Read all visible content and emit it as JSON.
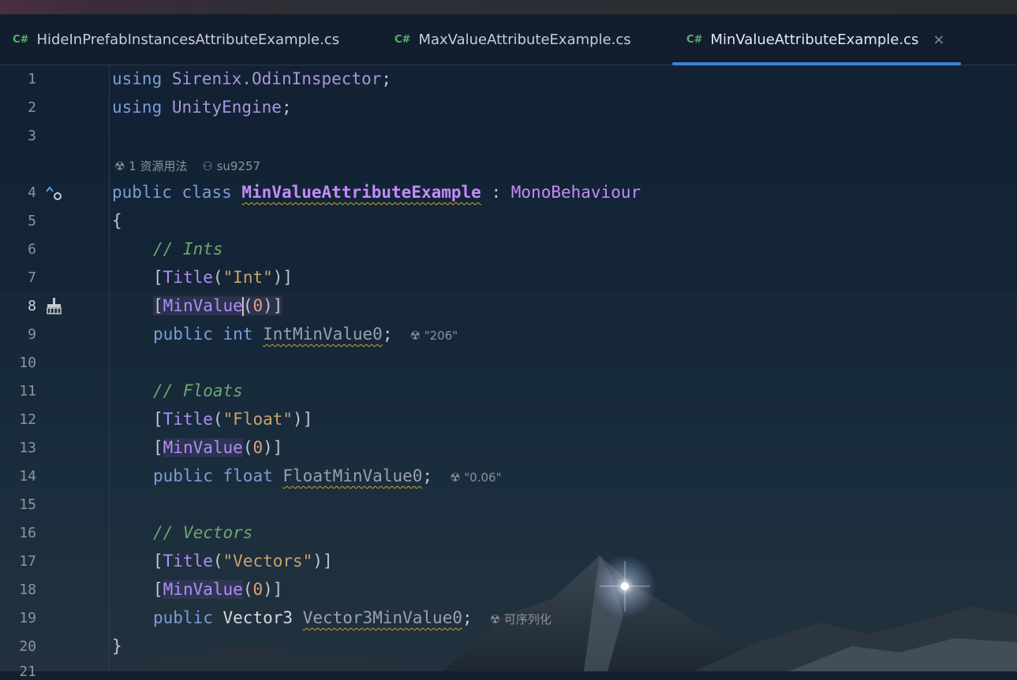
{
  "tabs": [
    {
      "lang": "C#",
      "label": "HideInPrefabInstancesAttributeExample.cs"
    },
    {
      "lang": "C#",
      "label": "MaxValueAttributeExample.cs"
    },
    {
      "lang": "C#",
      "label": "MinValueAttributeExample.cs",
      "close": "×"
    }
  ],
  "line_numbers": [
    "1",
    "2",
    "3",
    "4",
    "5",
    "6",
    "7",
    "8",
    "9",
    "10",
    "11",
    "12",
    "13",
    "14",
    "15",
    "16",
    "17",
    "18",
    "19",
    "20",
    "21"
  ],
  "codelens": {
    "usages": "1 资源用法",
    "author": "su9257"
  },
  "code": {
    "l1": {
      "kw": "using",
      "ns": "Sirenix.OdinInspector",
      "end": ";"
    },
    "l2": {
      "kw": "using",
      "ns": "UnityEngine",
      "end": ";"
    },
    "l4": {
      "kw1": "public",
      "kw2": "class",
      "name": "MinValueAttributeExample",
      "sep": " : ",
      "base": "MonoBehaviour"
    },
    "l5": "{",
    "l6": "// Ints",
    "l7": {
      "open": "[",
      "attr": "Title",
      "p1": "(",
      "str": "\"Int\"",
      "p2": ")]"
    },
    "l8": {
      "open": "[",
      "attr": "MinValue",
      "p1": "(",
      "num": "0",
      "p2": ")]"
    },
    "l9": {
      "kw1": "public",
      "kw2": "int",
      "field": "IntMinValue0",
      "end": ";",
      "inlay": "\"206\""
    },
    "l11": "// Floats",
    "l12": {
      "open": "[",
      "attr": "Title",
      "p1": "(",
      "str": "\"Float\"",
      "p2": ")]"
    },
    "l13": {
      "open": "[",
      "attr": "MinValue",
      "p1": "(",
      "num": "0",
      "p2": ")]"
    },
    "l14": {
      "kw1": "public",
      "kw2": "float",
      "field": "FloatMinValue0",
      "end": ";",
      "inlay": "\"0.06\""
    },
    "l16": "// Vectors",
    "l17": {
      "open": "[",
      "attr": "Title",
      "p1": "(",
      "str": "\"Vectors\"",
      "p2": ")]"
    },
    "l18": {
      "open": "[",
      "attr": "MinValue",
      "p1": "(",
      "num": "0",
      "p2": ")]"
    },
    "l19": {
      "kw1": "public",
      "type": "Vector3",
      "field": "Vector3MinValue0",
      "end": ";",
      "inlay": "可序列化"
    },
    "l20": "}"
  },
  "colors": {
    "accent": "#3b82d6",
    "keyword": "#7e9cd8",
    "class": "#c58af9",
    "string": "#c9a26d",
    "comment": "#6fa66d",
    "csharp": "#57b36b"
  }
}
